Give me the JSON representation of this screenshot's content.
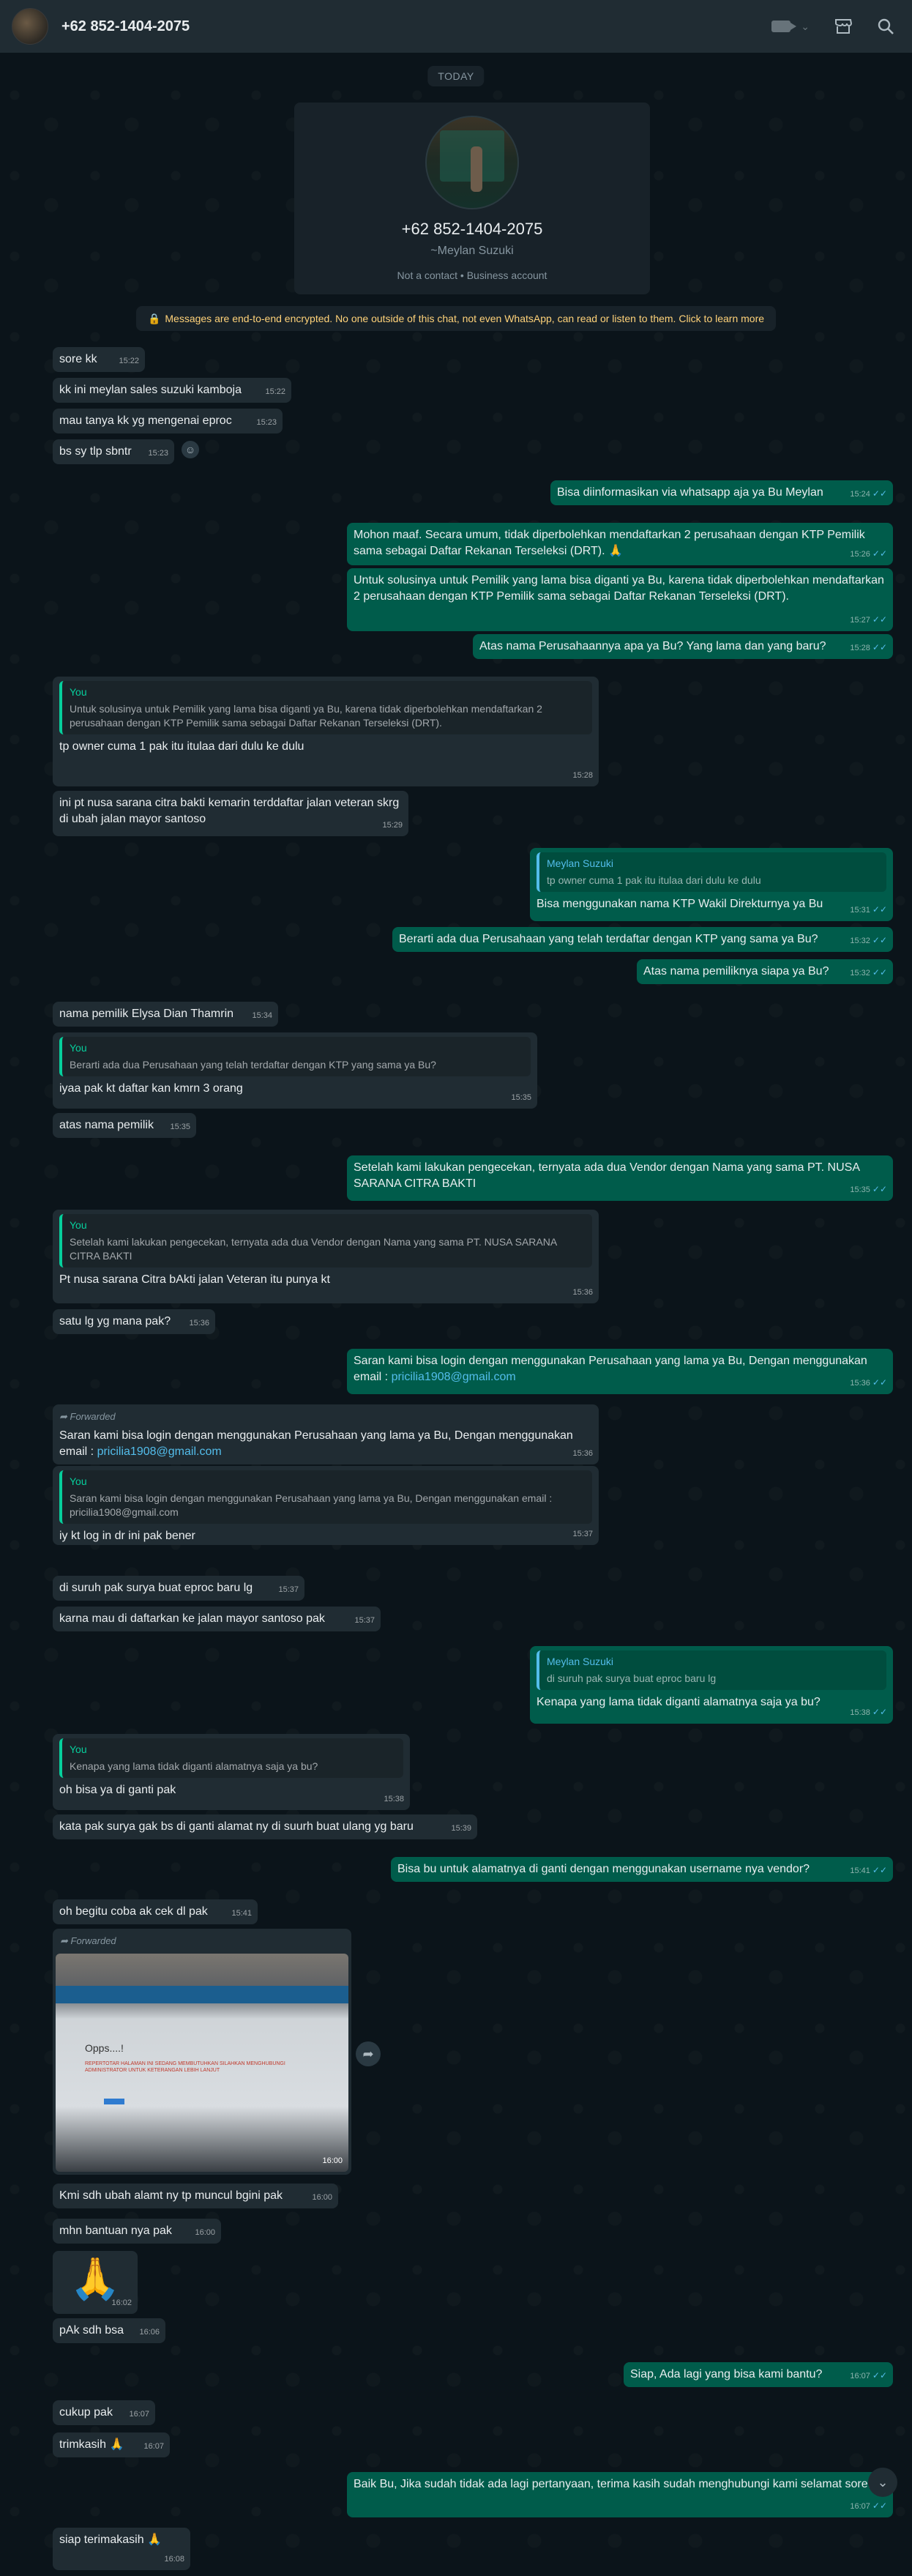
{
  "header": {
    "title": "+62 852-1404-2075",
    "video_icon": "video-camera-icon",
    "store_icon": "storefront-icon",
    "search_icon": "search-icon"
  },
  "chat": {
    "day_chip": "TODAY",
    "profile": {
      "number": "+62 852-1404-2075",
      "display_name": "~Meylan Suzuki",
      "meta": "Not a contact • Business account"
    },
    "e2e_notice": "Messages are end-to-end encrypted. No one outside of this chat, not even WhatsApp, can read or listen to them. Click to learn more",
    "messages": [
      {
        "text": "sore  kk",
        "time": "15:22"
      },
      {
        "text": "kk ini meylan sales suzuki kamboja",
        "time": "15:22"
      },
      {
        "text": "mau tanya kk yg mengenai eproc",
        "time": "15:23"
      },
      {
        "text": "bs sy tlp sbntr",
        "time": "15:23"
      },
      {
        "text": "Bisa diinformasikan via whatsapp aja ya Bu Meylan",
        "time": "15:24"
      },
      {
        "text": "Mohon maaf. Secara umum, tidak diperbolehkan mendaftarkan 2 perusahaan dengan KTP Pemilik sama sebagai Daftar Rekanan Terseleksi (DRT). 🙏",
        "time": "15:26"
      },
      {
        "text": "Untuk solusinya untuk Pemilik yang lama bisa diganti ya Bu, karena  tidak diperbolehkan mendaftarkan 2 perusahaan dengan KTP Pemilik sama sebagai Daftar Rekanan Terseleksi (DRT).",
        "time": "15:27"
      },
      {
        "text": "Atas nama Perusahaannya apa ya Bu? Yang lama dan yang baru?",
        "time": "15:28"
      },
      {
        "quote_name": "You",
        "quote": "Untuk solusinya untuk Pemilik yang lama bisa diganti ya Bu, karena  tidak diperbolehkan mendaftarkan 2 perusahaan dengan KTP Pemilik sama sebagai Daftar Rekanan Terseleksi (DRT).",
        "text": "tp owner cuma 1 pak itu itulaa dari dulu ke dulu",
        "time": "15:28"
      },
      {
        "text": "ini pt nusa sarana citra bakti kemarin terddaftar jalan veteran skrg di ubah jalan mayor santoso",
        "time": "15:29"
      },
      {
        "quote_name": "Meylan Suzuki",
        "quote": "tp owner cuma 1 pak itu itulaa dari dulu ke dulu",
        "text": "Bisa menggunakan nama KTP Wakil Direkturnya ya Bu",
        "time": "15:31"
      },
      {
        "text": "Berarti ada dua Perusahaan yang telah terdaftar dengan KTP yang sama ya Bu?",
        "time": "15:32"
      },
      {
        "text": "Atas nama pemiliknya siapa ya Bu?",
        "time": "15:32"
      },
      {
        "text": "nama pemilik Elysa Dian Thamrin",
        "time": "15:34"
      },
      {
        "quote_name": "You",
        "quote": "Berarti ada dua Perusahaan yang telah terdaftar dengan KTP yang sama ya Bu?",
        "text": "iyaa pak kt daftar kan kmrn 3 orang",
        "time": "15:35"
      },
      {
        "text": "atas nama pemilik",
        "time": "15:35"
      },
      {
        "text": "Setelah kami lakukan pengecekan, ternyata ada dua Vendor dengan Nama yang sama PT. NUSA SARANA CITRA BAKTI",
        "time": "15:35"
      },
      {
        "quote_name": "You",
        "quote": "Setelah kami lakukan pengecekan, ternyata ada dua Vendor dengan Nama yang sama PT. NUSA SARANA CITRA BAKTI",
        "text": "Pt nusa sarana Citra bAkti jalan Veteran itu punya kt",
        "time": "15:36"
      },
      {
        "text": "satu lg yg mana pak?",
        "time": "15:36"
      },
      {
        "text": "Saran kami bisa login dengan menggunakan Perusahaan yang lama ya Bu, Dengan menggunakan email : ",
        "link": "pricilia1908@gmail.com",
        "time": "15:36"
      },
      {
        "forwarded": "Forwarded",
        "text": "Saran kami bisa login dengan menggunakan Perusahaan yang lama ya Bu, Dengan menggunakan email : ",
        "link": "pricilia1908@gmail.com",
        "time": "15:36"
      },
      {
        "quote_name": "You",
        "quote": "Saran kami bisa login dengan menggunakan Perusahaan yang lama ya Bu, Dengan menggunakan email : pricilia1908@gmail.com",
        "text": "iy kt log in dr ini pak bener",
        "time": "15:37"
      },
      {
        "text": "di suruh pak surya buat eproc baru lg",
        "time": "15:37"
      },
      {
        "text": "karna mau di daftarkan ke jalan mayor santoso pak",
        "time": "15:37"
      },
      {
        "quote_name": "Meylan Suzuki",
        "quote": "di suruh pak surya buat eproc baru lg",
        "text": "Kenapa yang lama tidak diganti alamatnya saja ya bu?",
        "time": "15:38"
      },
      {
        "quote_name": "You",
        "quote": "Kenapa yang lama tidak diganti alamatnya saja ya bu?",
        "text": "oh bisa ya di ganti pak",
        "time": "15:38"
      },
      {
        "text": "kata pak surya gak bs di ganti alamat ny di suurh buat ulang yg baru",
        "time": "15:39"
      },
      {
        "text": "Bisa bu untuk alamatnya di ganti dengan menggunakan username nya vendor?",
        "time": "15:41"
      },
      {
        "text": "oh begitu coba ak cek dl pak",
        "time": "15:41"
      },
      {
        "forwarded": "Forwarded",
        "image_caption": "Opps....!",
        "image_error": "REPERTOTAR HALAMAN INI SEDANG MEMBUTUHKAN SILAHKAN MENGHUBUNGI ADMINISTRATOR UNTUK KETERANGAN LEBIH LANJUT",
        "time": "16:00"
      },
      {
        "text": "Kmi sdh ubah alamt ny tp muncul bgini pak",
        "time": "16:00"
      },
      {
        "text": "mhn bantuan nya pak",
        "time": "16:00"
      },
      {
        "text": "🙏",
        "time": "16:02"
      },
      {
        "text": "pAk sdh bsa",
        "time": "16:06"
      },
      {
        "text": "Siap, Ada lagi yang  bisa kami bantu?",
        "time": "16:07"
      },
      {
        "text": "cukup pak",
        "time": "16:07"
      },
      {
        "text": "trimkasih 🙏",
        "time": "16:07"
      },
      {
        "text": "Baik Bu, Jika sudah tidak ada lagi pertanyaan, terima kasih sudah menghubungi kami selamat sore.",
        "time": "16:07"
      },
      {
        "text": "siap terimakasih 🙏",
        "time": "16:08"
      }
    ]
  },
  "colors": {
    "background": "#0b141a",
    "header": "#202c33",
    "incoming": "#202c33",
    "outgoing": "#005c4b",
    "read_ticks": "#53bdeb",
    "link": "#53bdeb",
    "quote_accent": "#06cf9c"
  }
}
